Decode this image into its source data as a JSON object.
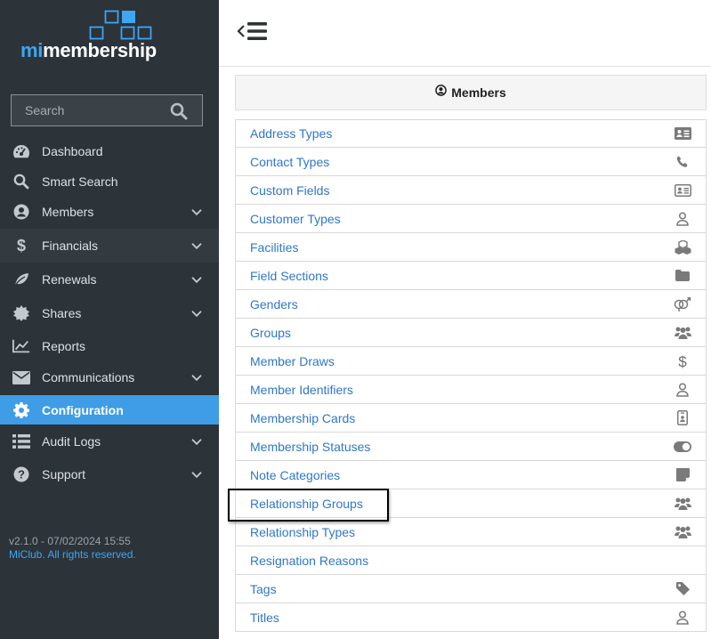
{
  "brand": {
    "logo_prefix": "mi",
    "logo_suffix": "membership"
  },
  "search": {
    "placeholder": "Search"
  },
  "sidebar": {
    "items": [
      {
        "label": "Dashboard",
        "icon": "gauge-icon",
        "has_submenu": false
      },
      {
        "label": "Smart Search",
        "icon": "search-icon",
        "has_submenu": false
      },
      {
        "label": "Members",
        "icon": "user-circle-icon",
        "has_submenu": true
      },
      {
        "label": "Financials",
        "icon": "dollar-icon",
        "has_submenu": true
      },
      {
        "label": "Renewals",
        "icon": "leaf-icon",
        "has_submenu": true
      },
      {
        "label": "Shares",
        "icon": "certificate-icon",
        "has_submenu": true
      },
      {
        "label": "Reports",
        "icon": "line-chart-icon",
        "has_submenu": false
      },
      {
        "label": "Communications",
        "icon": "envelope-icon",
        "has_submenu": true
      },
      {
        "label": "Configuration",
        "icon": "gear-icon",
        "has_submenu": false,
        "active": true
      },
      {
        "label": "Audit Logs",
        "icon": "list-icon",
        "has_submenu": true
      },
      {
        "label": "Support",
        "icon": "question-circle-icon",
        "has_submenu": true
      }
    ],
    "version": "v2.1.0 - 07/02/2024 15:55",
    "copyright": "MiClub. All rights reserved."
  },
  "panel": {
    "title": "Members",
    "items": [
      {
        "label": "Address Types",
        "icon": "address-card-icon"
      },
      {
        "label": "Contact Types",
        "icon": "phone-icon"
      },
      {
        "label": "Custom Fields",
        "icon": "id-card-icon"
      },
      {
        "label": "Customer Types",
        "icon": "user-outline-icon"
      },
      {
        "label": "Facilities",
        "icon": "cubes-icon"
      },
      {
        "label": "Field Sections",
        "icon": "folder-icon"
      },
      {
        "label": "Genders",
        "icon": "genderless-icon"
      },
      {
        "label": "Groups",
        "icon": "users-icon"
      },
      {
        "label": "Member Draws",
        "icon": "dollar-icon"
      },
      {
        "label": "Member Identifiers",
        "icon": "user-outline-icon"
      },
      {
        "label": "Membership Cards",
        "icon": "id-badge-icon"
      },
      {
        "label": "Membership Statuses",
        "icon": "toggle-on-icon"
      },
      {
        "label": "Note Categories",
        "icon": "sticky-note-icon"
      },
      {
        "label": "Relationship Groups",
        "icon": "users-icon",
        "highlighted": true
      },
      {
        "label": "Relationship Types",
        "icon": "users-icon"
      },
      {
        "label": "Resignation Reasons",
        "icon": ""
      },
      {
        "label": "Tags",
        "icon": "tag-icon"
      },
      {
        "label": "Titles",
        "icon": "user-outline-icon"
      }
    ]
  },
  "colors": {
    "sidebar_bg": "#2c3339",
    "accent": "#3f9ce6",
    "brand_blue": "#3ea6f2",
    "link": "#2f77c9",
    "icon_grey": "#7a7a7a"
  }
}
